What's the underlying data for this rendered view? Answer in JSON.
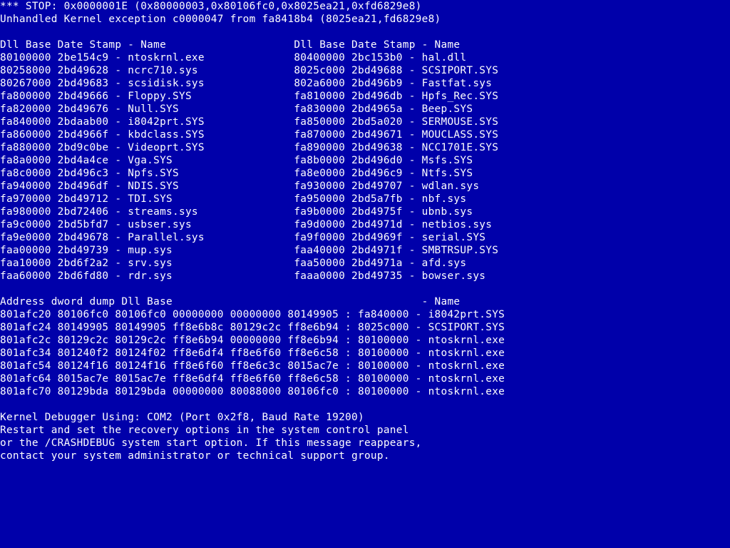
{
  "stop_line": "*** STOP: 0x0000001E (0x80000003,0x80106fc0,0x8025ea21,0xfd6829e8)",
  "exception_line": "Unhandled Kernel exception c0000047 from fa8418b4 (8025ea21,fd6829e8)",
  "dll_header_left": "Dll Base Date Stamp - Name",
  "dll_header_right": "Dll Base Date Stamp - Name",
  "dll_rows": [
    {
      "lb": "80100000",
      "ld": "2be154c9",
      "ln": "ntoskrnl.exe",
      "rb": "80400000",
      "rd": "2bc153b0",
      "rn": "hal.dll"
    },
    {
      "lb": "80258000",
      "ld": "2bd49628",
      "ln": "ncrc710.sys",
      "rb": "8025c000",
      "rd": "2bd49688",
      "rn": "SCSIPORT.SYS"
    },
    {
      "lb": "80267000",
      "ld": "2bd49683",
      "ln": "scsidisk.sys",
      "rb": "802a6000",
      "rd": "2bd496b9",
      "rn": "Fastfat.sys"
    },
    {
      "lb": "fa800000",
      "ld": "2bd49666",
      "ln": "Floppy.SYS",
      "rb": "fa810000",
      "rd": "2bd496db",
      "rn": "Hpfs_Rec.SYS"
    },
    {
      "lb": "fa820000",
      "ld": "2bd49676",
      "ln": "Null.SYS",
      "rb": "fa830000",
      "rd": "2bd4965a",
      "rn": "Beep.SYS"
    },
    {
      "lb": "fa840000",
      "ld": "2bdaab00",
      "ln": "i8042prt.SYS",
      "rb": "fa850000",
      "rd": "2bd5a020",
      "rn": "SERMOUSE.SYS"
    },
    {
      "lb": "fa860000",
      "ld": "2bd4966f",
      "ln": "kbdclass.SYS",
      "rb": "fa870000",
      "rd": "2bd49671",
      "rn": "MOUCLASS.SYS"
    },
    {
      "lb": "fa880000",
      "ld": "2bd9c0be",
      "ln": "Videoprt.SYS",
      "rb": "fa890000",
      "rd": "2bd49638",
      "rn": "NCC1701E.SYS"
    },
    {
      "lb": "fa8a0000",
      "ld": "2bd4a4ce",
      "ln": "Vga.SYS",
      "rb": "fa8b0000",
      "rd": "2bd496d0",
      "rn": "Msfs.SYS"
    },
    {
      "lb": "fa8c0000",
      "ld": "2bd496c3",
      "ln": "Npfs.SYS",
      "rb": "fa8e0000",
      "rd": "2bd496c9",
      "rn": "Ntfs.SYS"
    },
    {
      "lb": "fa940000",
      "ld": "2bd496df",
      "ln": "NDIS.SYS",
      "rb": "fa930000",
      "rd": "2bd49707",
      "rn": "wdlan.sys"
    },
    {
      "lb": "fa970000",
      "ld": "2bd49712",
      "ln": "TDI.SYS",
      "rb": "fa950000",
      "rd": "2bd5a7fb",
      "rn": "nbf.sys"
    },
    {
      "lb": "fa980000",
      "ld": "2bd72406",
      "ln": "streams.sys",
      "rb": "fa9b0000",
      "rd": "2bd4975f",
      "rn": "ubnb.sys"
    },
    {
      "lb": "fa9c0000",
      "ld": "2bd5bfd7",
      "ln": "usbser.sys",
      "rb": "fa9d0000",
      "rd": "2bd4971d",
      "rn": "netbios.sys"
    },
    {
      "lb": "fa9e0000",
      "ld": "2bd49678",
      "ln": "Parallel.sys",
      "rb": "fa9f0000",
      "rd": "2bd4969f",
      "rn": "serial.SYS"
    },
    {
      "lb": "faa00000",
      "ld": "2bd49739",
      "ln": "mup.sys",
      "rb": "faa40000",
      "rd": "2bd4971f",
      "rn": "SMBTRSUP.SYS"
    },
    {
      "lb": "faa10000",
      "ld": "2bd6f2a2",
      "ln": "srv.sys",
      "rb": "faa50000",
      "rd": "2bd4971a",
      "rn": "afd.sys"
    },
    {
      "lb": "faa60000",
      "ld": "2bd6fd80",
      "ln": "rdr.sys",
      "rb": "faaa0000",
      "rd": "2bd49735",
      "rn": "bowser.sys"
    }
  ],
  "dump_header": "Address dword dump Dll Base                                       - Name",
  "dump_rows": [
    {
      "a": "801afc20",
      "d1": "80106fc0",
      "d2": "80106fc0",
      "d3": "00000000",
      "d4": "00000000",
      "d5": "80149905",
      "db": "fa840000",
      "dn": "i8042prt.SYS"
    },
    {
      "a": "801afc24",
      "d1": "80149905",
      "d2": "80149905",
      "d3": "ff8e6b8c",
      "d4": "80129c2c",
      "d5": "ff8e6b94",
      "db": "8025c000",
      "dn": "SCSIPORT.SYS"
    },
    {
      "a": "801afc2c",
      "d1": "80129c2c",
      "d2": "80129c2c",
      "d3": "ff8e6b94",
      "d4": "00000000",
      "d5": "ff8e6b94",
      "db": "80100000",
      "dn": "ntoskrnl.exe"
    },
    {
      "a": "801afc34",
      "d1": "801240f2",
      "d2": "80124f02",
      "d3": "ff8e6df4",
      "d4": "ff8e6f60",
      "d5": "ff8e6c58",
      "db": "80100000",
      "dn": "ntoskrnl.exe"
    },
    {
      "a": "801afc54",
      "d1": "80124f16",
      "d2": "80124f16",
      "d3": "ff8e6f60",
      "d4": "ff8e6c3c",
      "d5": "8015ac7e",
      "db": "80100000",
      "dn": "ntoskrnl.exe"
    },
    {
      "a": "801afc64",
      "d1": "8015ac7e",
      "d2": "8015ac7e",
      "d3": "ff8e6df4",
      "d4": "ff8e6f60",
      "d5": "ff8e6c58",
      "db": "80100000",
      "dn": "ntoskrnl.exe"
    },
    {
      "a": "801afc70",
      "d1": "80129bda",
      "d2": "80129bda",
      "d3": "00000000",
      "d4": "80088000",
      "d5": "80106fc0",
      "db": "80100000",
      "dn": "ntoskrnl.exe"
    }
  ],
  "debugger_line": "Kernel Debugger Using: COM2 (Port 0x2f8, Baud Rate 19200)",
  "instr1": "Restart and set the recovery options in the system control panel",
  "instr2": "or the /CRASHDEBUG system start option. If this message reappears,",
  "instr3": "contact your system administrator or technical support group."
}
